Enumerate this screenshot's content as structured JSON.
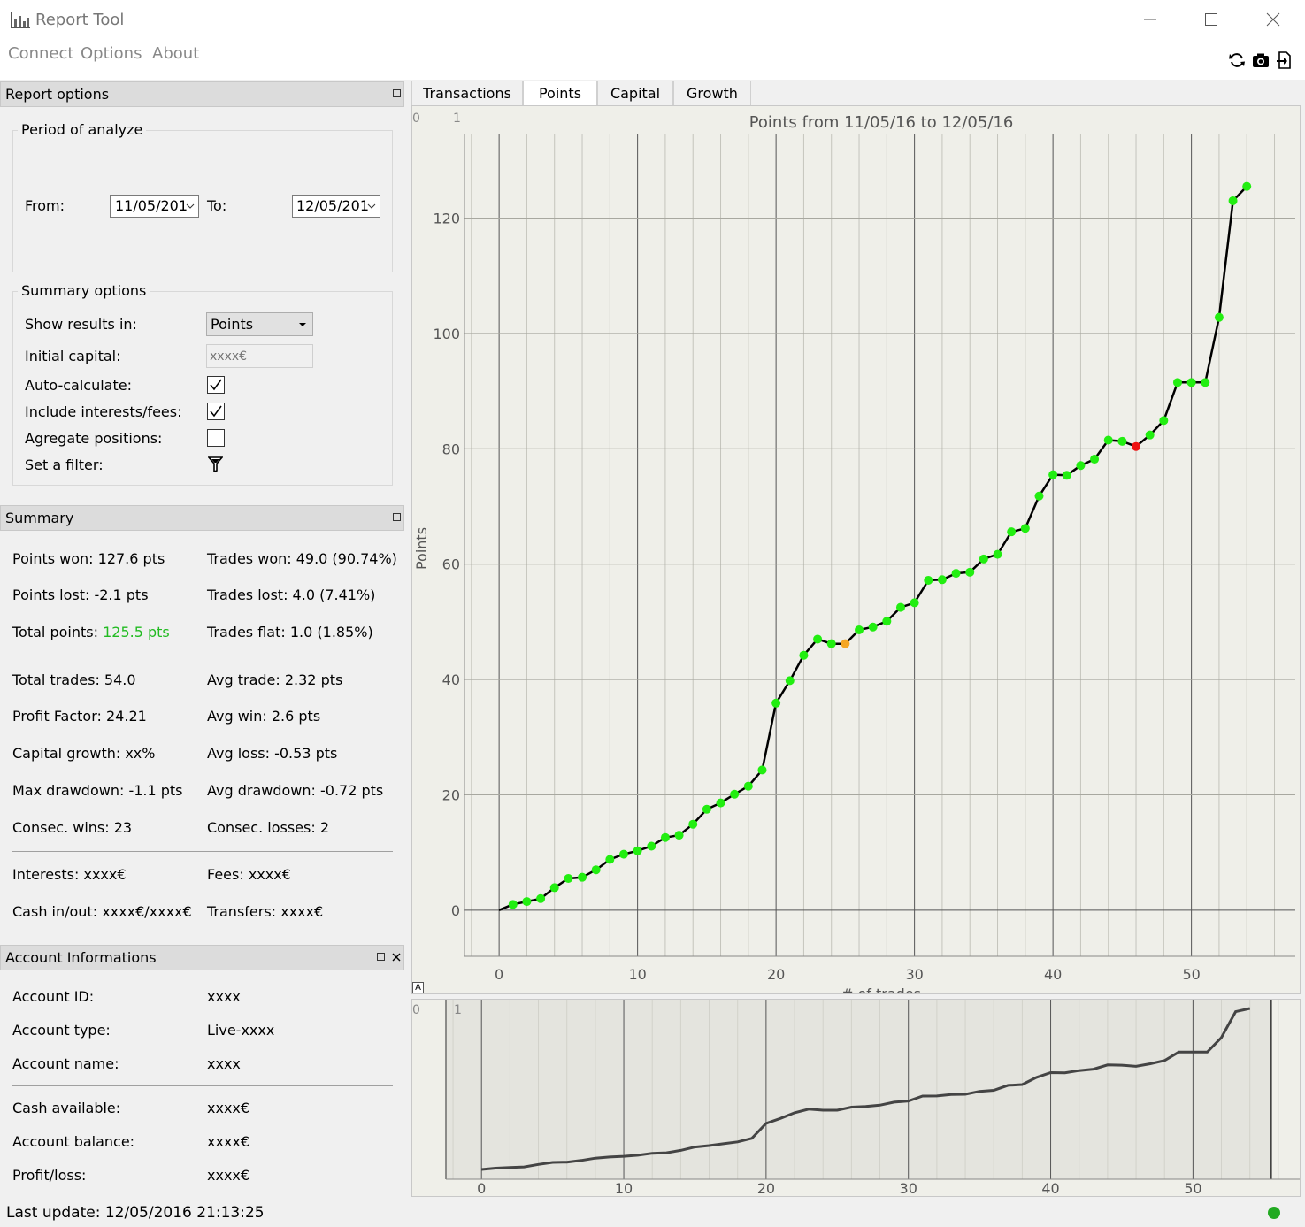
{
  "app": {
    "title": "Report Tool"
  },
  "window": {
    "minimize": "—",
    "maximize": "☐",
    "close": "✕"
  },
  "menu": [
    "Connect",
    "Options",
    "About"
  ],
  "toolbar_icons": [
    "refresh-icon",
    "camera-icon",
    "export-icon"
  ],
  "report_options": {
    "header": "Report options",
    "period_title": "Period of analyze",
    "from_label": "From:",
    "from_value": "11/05/201",
    "to_label": "To:",
    "to_value": "12/05/201",
    "summary_title": "Summary options",
    "show_results_label": "Show results in:",
    "show_results_value": "Points",
    "initial_capital_label": "Initial capital:",
    "initial_capital_placeholder": "xxxx€",
    "auto_calc_label": "Auto-calculate:",
    "auto_calc_checked": true,
    "include_fees_label": "Include interests/fees:",
    "include_fees_checked": true,
    "aggregate_label": "Agregate positions:",
    "aggregate_checked": false,
    "filter_label": "Set a filter:"
  },
  "summary": {
    "header": "Summary",
    "rows1": [
      [
        "Points won: 127.6 pts",
        "Trades won: 49.0 (90.74%)"
      ],
      [
        "Points lost: -2.1 pts",
        "Trades lost: 4.0 (7.41%)"
      ]
    ],
    "total_points_label": "Total points: ",
    "total_points_value": "125.5 pts",
    "trades_flat": "Trades flat: 1.0 (1.85%)",
    "rows2": [
      [
        "Total trades: 54.0",
        "Avg trade: 2.32 pts"
      ],
      [
        "Profit Factor: 24.21",
        "Avg win: 2.6 pts"
      ],
      [
        "Capital growth: xx%",
        "Avg loss: -0.53 pts"
      ],
      [
        "Max drawdown: -1.1 pts",
        "Avg drawdown: -0.72 pts"
      ],
      [
        "Consec. wins: 23",
        "Consec. losses: 2"
      ]
    ],
    "rows3": [
      [
        "Interests: xxxx€",
        "Fees: xxxx€"
      ],
      [
        "Cash in/out: xxxx€/xxxx€",
        "Transfers: xxxx€"
      ]
    ],
    "positive_color": "#22bb22"
  },
  "account": {
    "header": "Account Informations",
    "rows1": [
      [
        "Account ID:",
        "xxxx"
      ],
      [
        "Account type:",
        "Live-xxxx"
      ],
      [
        "Account name:",
        "xxxx"
      ]
    ],
    "rows2": [
      [
        "Cash available:",
        "xxxx€"
      ],
      [
        "Account balance:",
        "xxxx€"
      ],
      [
        "Profit/loss:",
        "xxxx€"
      ]
    ]
  },
  "status": {
    "last_update": "Last update: 12/05/2016 21:13:25",
    "connection_color": "#22aa22"
  },
  "tabs": [
    "Transactions",
    "Points",
    "Capital",
    "Growth"
  ],
  "active_tab": "Points",
  "chart_data": {
    "type": "line",
    "title": "Points from 11/05/16 to 12/05/16",
    "xlabel": "# of trades",
    "ylabel": "Points",
    "xlim": [
      -2.5,
      57.5
    ],
    "ylim": [
      -8,
      134.5
    ],
    "xticks": [
      0,
      10,
      20,
      30,
      40,
      50
    ],
    "yticks": [
      0,
      20,
      40,
      60,
      80,
      100,
      120
    ],
    "corner_labels": [
      "0",
      "1"
    ],
    "overview_corner_labels": [
      "0",
      "1"
    ],
    "overview_xlim": [
      -2.5,
      57.5
    ],
    "overview_view_range": [
      -2.5,
      55.5
    ],
    "point_colors": {
      "win": "#22ee11",
      "flat": "#f5a623",
      "loss": "#ee1111"
    },
    "line_color": "#000000",
    "x": [
      0,
      1,
      2,
      3,
      4,
      5,
      6,
      7,
      8,
      9,
      10,
      11,
      12,
      13,
      14,
      15,
      16,
      17,
      18,
      19,
      20,
      21,
      22,
      23,
      24,
      25,
      26,
      27,
      28,
      29,
      30,
      31,
      32,
      33,
      34,
      35,
      36,
      37,
      38,
      39,
      40,
      41,
      42,
      43,
      44,
      45,
      46,
      47,
      48,
      49,
      50,
      51,
      52,
      53,
      54
    ],
    "y": [
      0,
      1.0,
      1.5,
      2.0,
      3.9,
      5.5,
      5.7,
      7.0,
      8.8,
      9.7,
      10.3,
      11.1,
      12.6,
      13.0,
      14.9,
      17.5,
      18.6,
      20.1,
      21.5,
      24.3,
      35.9,
      39.8,
      44.2,
      47.0,
      46.2,
      46.2,
      48.6,
      49.1,
      50.1,
      52.5,
      53.3,
      57.2,
      57.3,
      58.4,
      58.6,
      60.9,
      61.7,
      65.6,
      66.2,
      71.8,
      75.5,
      75.4,
      77.1,
      78.2,
      81.5,
      81.3,
      80.4,
      82.4,
      84.9,
      91.5,
      91.5,
      91.5,
      102.8,
      123.0,
      125.5
    ],
    "status": [
      "start",
      "win",
      "win",
      "win",
      "win",
      "win",
      "win",
      "win",
      "win",
      "win",
      "win",
      "win",
      "win",
      "win",
      "win",
      "win",
      "win",
      "win",
      "win",
      "win",
      "win",
      "win",
      "win",
      "win",
      "win",
      "flat",
      "win",
      "win",
      "win",
      "win",
      "win",
      "win",
      "win",
      "win",
      "win",
      "win",
      "win",
      "win",
      "win",
      "win",
      "win",
      "win",
      "win",
      "win",
      "win",
      "win",
      "loss",
      "win",
      "win",
      "win",
      "win",
      "win",
      "win",
      "win",
      "win"
    ]
  }
}
